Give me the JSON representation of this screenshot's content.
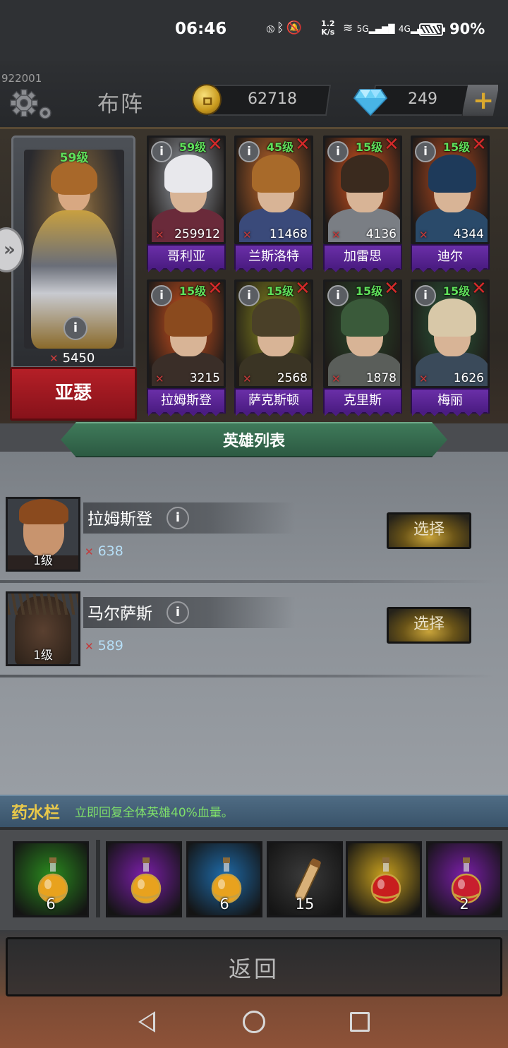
{
  "status_bar": {
    "time": "06:46",
    "speed_top": "1.2",
    "speed_bottom": "K/s",
    "battery": "90%",
    "icons": [
      "nfc-icon",
      "bluetooth-icon",
      "mute-icon",
      "wifi-icon",
      "5g-signal-icon",
      "4g-signal-icon",
      "battery-icon"
    ]
  },
  "header": {
    "user_id": "922001",
    "title": "布阵",
    "gold": "62718",
    "diamonds": "249"
  },
  "leader": {
    "level": "59级",
    "power": "5450",
    "name": "亚瑟",
    "info_label": "i"
  },
  "formation": [
    {
      "name": "哥利亚",
      "level": "59级",
      "power": "259912",
      "bg": "#9aa0a8",
      "hair": "#e8e8ec",
      "body": "#6a2a3a"
    },
    {
      "name": "兰斯洛特",
      "level": "45级",
      "power": "11468",
      "bg": "#c96a2a",
      "hair": "#a86a2a",
      "body": "#3a4a7a"
    },
    {
      "name": "加雷思",
      "level": "15级",
      "power": "4136",
      "bg": "#d8541e",
      "hair": "#3a2a1e",
      "body": "#7a7e84"
    },
    {
      "name": "迪尔",
      "level": "15级",
      "power": "4344",
      "bg": "#b84a1e",
      "hair": "#1e3a5a",
      "body": "#2a4a6a"
    },
    {
      "name": "拉姆斯登",
      "level": "15级",
      "power": "3215",
      "bg": "#d8541e",
      "hair": "#8a4a1e",
      "body": "#3a2e28"
    },
    {
      "name": "萨克斯顿",
      "level": "15级",
      "power": "2568",
      "bg": "#8a8a1e",
      "hair": "#4a4028",
      "body": "#3a3424"
    },
    {
      "name": "克里斯",
      "level": "15级",
      "power": "1878",
      "bg": "#2a4a2a",
      "hair": "#3a5a3a",
      "body": "#5a5e5a"
    },
    {
      "name": "梅丽",
      "level": "15级",
      "power": "1626",
      "bg": "#2a5a3a",
      "hair": "#d8c8a8",
      "body": "#3a4a5a"
    }
  ],
  "hero_list": {
    "title": "英雄列表",
    "rows": [
      {
        "name": "拉姆斯登",
        "level": "1级",
        "power": "638",
        "button": "选择"
      },
      {
        "name": "马尔萨斯",
        "level": "1级",
        "power": "589",
        "button": "选择"
      }
    ]
  },
  "potions": {
    "title": "药水栏",
    "description": "立即回复全体英雄40%血量。",
    "items": [
      {
        "bg": "#2a8a1e",
        "liquid": "#e8a21e",
        "count": "6"
      },
      {
        "bg": "#7a1ea8",
        "liquid": "#e8a21e",
        "count": ""
      },
      {
        "bg": "#1e6aa8",
        "liquid": "#e8a21e",
        "count": "6"
      },
      {
        "bg": "#3a3a3a",
        "liquid": "#d8b078",
        "count": "15"
      },
      {
        "bg": "#c8a01e",
        "liquid": "#c81e1e",
        "count": ""
      },
      {
        "bg": "#7a1ea8",
        "liquid": "#c81e2e",
        "count": "2"
      }
    ]
  },
  "footer": {
    "return_label": "返回"
  }
}
